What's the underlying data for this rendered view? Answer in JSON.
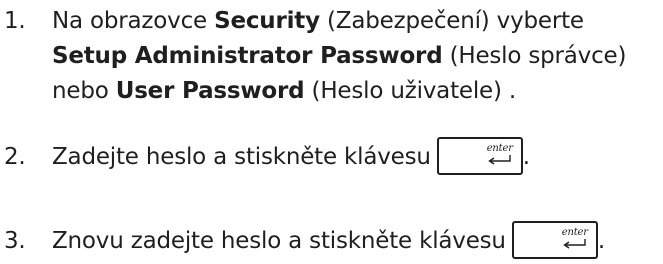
{
  "steps": [
    {
      "number": "1.",
      "parts": {
        "p1": "Na obrazovce ",
        "b1": "Security",
        "p2": " (Zabezpečení) vyberte ",
        "b2": "Setup Administrator Password",
        "p3": " (Heslo správce) nebo ",
        "b3": "User Password",
        "p4": " (Heslo uživatele) ."
      }
    },
    {
      "number": "2.",
      "text": "Zadejte heslo a stiskněte klávesu",
      "key_label": "enter",
      "trailing": "."
    },
    {
      "number": "3.",
      "text": "Znovu zadejte heslo a stiskněte klávesu",
      "key_label": "enter",
      "trailing": "."
    }
  ],
  "icons": {
    "enter_key": "enter-key-icon"
  },
  "colors": {
    "text": "#1f1f1f",
    "background": "#ffffff"
  }
}
